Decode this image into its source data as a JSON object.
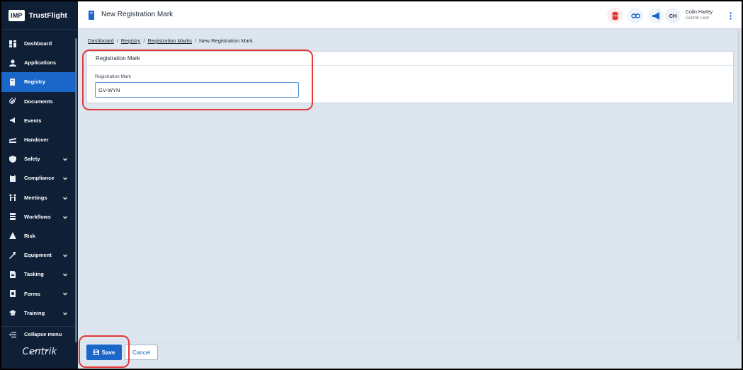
{
  "brand": {
    "badge": "IMP",
    "name": "TrustFlight"
  },
  "sidebar": {
    "items": [
      {
        "label": "Dashboard",
        "icon": "dashboard-icon",
        "active": false,
        "expandable": false
      },
      {
        "label": "Applications",
        "icon": "person-icon",
        "active": false,
        "expandable": false
      },
      {
        "label": "Registry",
        "icon": "book-icon",
        "active": true,
        "expandable": false
      },
      {
        "label": "Documents",
        "icon": "paperclip-icon",
        "active": false,
        "expandable": false
      },
      {
        "label": "Events",
        "icon": "megaphone-icon",
        "active": false,
        "expandable": false
      },
      {
        "label": "Handover",
        "icon": "handover-icon",
        "active": false,
        "expandable": false
      },
      {
        "label": "Safety",
        "icon": "shield-icon",
        "active": false,
        "expandable": true
      },
      {
        "label": "Compliance",
        "icon": "clipboard-icon",
        "active": false,
        "expandable": true
      },
      {
        "label": "Meetings",
        "icon": "meeting-icon",
        "active": false,
        "expandable": true
      },
      {
        "label": "Workflows",
        "icon": "workflow-icon",
        "active": false,
        "expandable": true
      },
      {
        "label": "Risk",
        "icon": "warning-icon",
        "active": false,
        "expandable": false
      },
      {
        "label": "Equipment",
        "icon": "wrench-icon",
        "active": false,
        "expandable": true
      },
      {
        "label": "Tasking",
        "icon": "task-icon",
        "active": false,
        "expandable": true
      },
      {
        "label": "Forms",
        "icon": "form-icon",
        "active": false,
        "expandable": true
      },
      {
        "label": "Training",
        "icon": "graduation-cap-icon",
        "active": false,
        "expandable": true
      }
    ],
    "collapse_label": "Collapse menu",
    "footer_logo": "Centrik"
  },
  "header": {
    "title": "New Registration Mark",
    "user": {
      "initials": "CH",
      "name": "Colin Harley",
      "role": "Centrik User"
    }
  },
  "breadcrumb": {
    "items": [
      "Dashboard",
      "Registry",
      "Registration Marks"
    ],
    "current": "New Registration Mark"
  },
  "form": {
    "section_title": "Registration Mark",
    "field_label": "Registration Mark",
    "field_value": "GV-WYN"
  },
  "footer": {
    "save_label": "Save",
    "cancel_label": "Cancel"
  },
  "colors": {
    "sidebar": "#0f1f36",
    "accent": "#1a66c9",
    "highlight": "#e5383b",
    "background": "#dde5ee"
  }
}
